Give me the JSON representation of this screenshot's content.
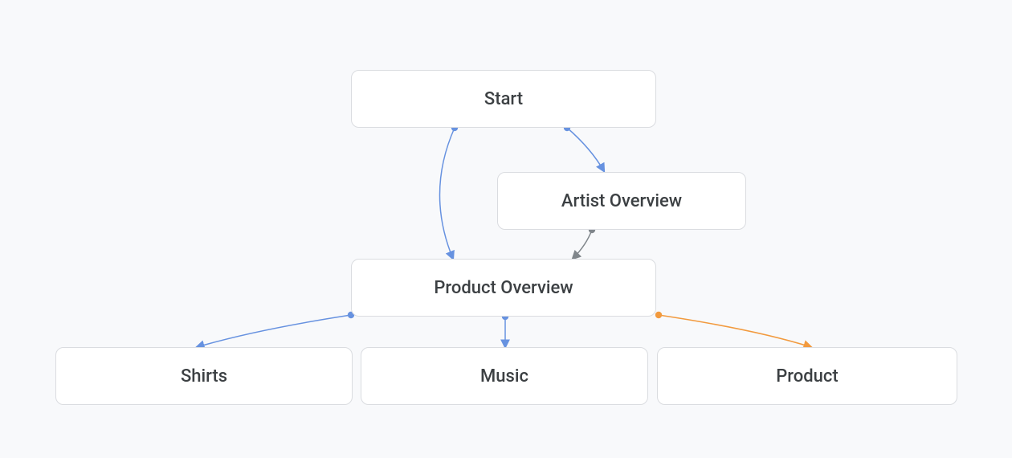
{
  "nodes": {
    "start": {
      "label": "Start"
    },
    "artist_overview": {
      "label": "Artist Overview"
    },
    "product_overview": {
      "label": "Product Overview"
    },
    "shirts": {
      "label": "Shirts"
    },
    "music": {
      "label": "Music"
    },
    "product": {
      "label": "Product"
    }
  },
  "colors": {
    "blue": "#6792e0",
    "gray": "#80868b",
    "orange": "#f29a3e"
  }
}
